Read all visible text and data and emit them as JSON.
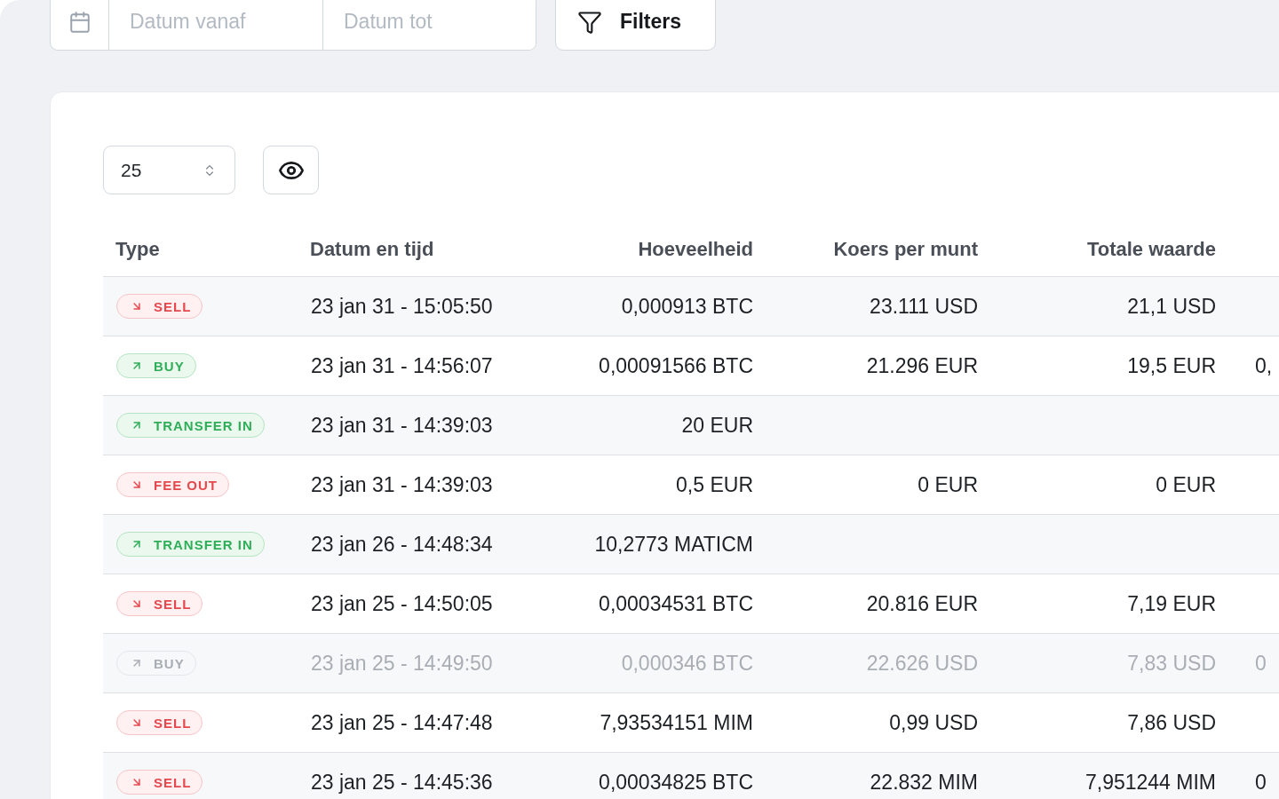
{
  "date_range": {
    "from_placeholder": "Datum vanaf",
    "to_placeholder": "Datum tot"
  },
  "filters_button": {
    "label": "Filters"
  },
  "page_size": {
    "value": "25"
  },
  "table": {
    "columns": [
      "Type",
      "Datum en tijd",
      "Hoeveelheid",
      "Koers per munt",
      "Totale waarde"
    ],
    "rows": [
      {
        "type": {
          "label": "SELL",
          "kind": "out"
        },
        "datum_en_tijd": "23 jan 31 - 15:05:50",
        "hoeveelheid": "0,000913 BTC",
        "koers_per_munt": "23.111 USD",
        "totale_waarde": "21,1 USD",
        "disabled": false
      },
      {
        "type": {
          "label": "BUY",
          "kind": "in"
        },
        "datum_en_tijd": "23 jan 31 - 14:56:07",
        "hoeveelheid": "0,00091566 BTC",
        "koers_per_munt": "21.296 EUR",
        "totale_waarde": "19,5 EUR",
        "column_6": "0,",
        "disabled": false
      },
      {
        "type": {
          "label": "TRANSFER IN",
          "kind": "in"
        },
        "datum_en_tijd": "23 jan 31 - 14:39:03",
        "hoeveelheid": "20 EUR",
        "disabled": false
      },
      {
        "type": {
          "label": "FEE OUT",
          "kind": "out"
        },
        "datum_en_tijd": "23 jan 31 - 14:39:03",
        "hoeveelheid": "0,5 EUR",
        "koers_per_munt": "0 EUR",
        "totale_waarde": "0 EUR",
        "disabled": false
      },
      {
        "type": {
          "label": "TRANSFER IN",
          "kind": "in"
        },
        "datum_en_tijd": "23 jan 26 - 14:48:34",
        "hoeveelheid": "10,2773 MATICM",
        "disabled": false
      },
      {
        "type": {
          "label": "SELL",
          "kind": "out"
        },
        "datum_en_tijd": "23 jan 25 - 14:50:05",
        "hoeveelheid": "0,00034531 BTC",
        "koers_per_munt": "20.816 EUR",
        "totale_waarde": "7,19 EUR",
        "disabled": false
      },
      {
        "type": {
          "label": "BUY",
          "kind": "in"
        },
        "datum_en_tijd": "23 jan 25 - 14:49:50",
        "hoeveelheid": "0,000346 BTC",
        "koers_per_munt": "22.626 USD",
        "totale_waarde": "7,83 USD",
        "column_6": "0",
        "disabled": true
      },
      {
        "type": {
          "label": "SELL",
          "kind": "out"
        },
        "datum_en_tijd": "23 jan 25 - 14:47:48",
        "hoeveelheid": "7,93534151 MIM",
        "koers_per_munt": "0,99 USD",
        "totale_waarde": "7,86 USD",
        "disabled": false
      },
      {
        "type": {
          "label": "SELL",
          "kind": "out"
        },
        "datum_en_tijd": "23 jan 25 - 14:45:36",
        "hoeveelheid": "0,00034825 BTC",
        "koers_per_munt": "22.832 MIM",
        "totale_waarde": "7,951244 MIM",
        "column_6": "0",
        "disabled": false
      }
    ]
  }
}
